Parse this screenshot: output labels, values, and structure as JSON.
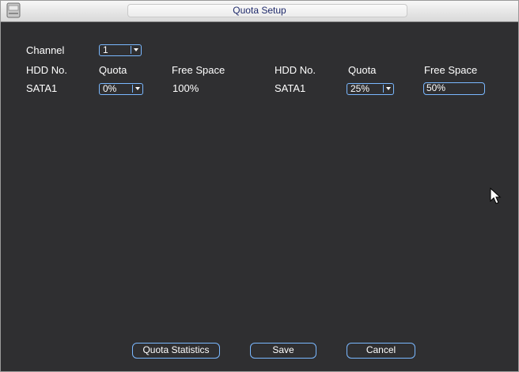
{
  "window": {
    "title": "Quota Setup",
    "app_icon": "hdd-icon"
  },
  "channel": {
    "label": "Channel",
    "value": "1"
  },
  "left_table": {
    "headers": [
      "HDD No.",
      "Quota",
      "Free Space"
    ],
    "row": {
      "hdd": "SATA1",
      "quota": "0%",
      "free_space": "100%"
    }
  },
  "right_table": {
    "headers": [
      "HDD No.",
      "Quota",
      "Free Space"
    ],
    "row": {
      "hdd": "SATA1",
      "quota": "25%",
      "free_space": "50%"
    }
  },
  "buttons": {
    "quota_statistics": "Quota Statistics",
    "save": "Save",
    "cancel": "Cancel"
  },
  "colors": {
    "background": "#2f2f31",
    "accent_border": "#7ab8ff",
    "title_text": "#1f2a6b"
  }
}
